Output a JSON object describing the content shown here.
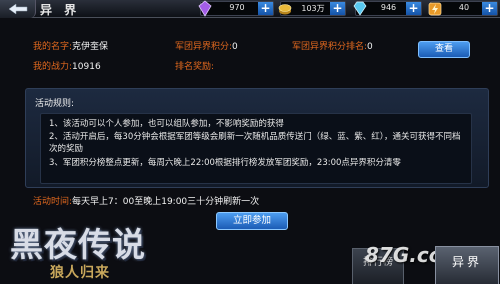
{
  "header": {
    "title": "异 界",
    "resources": [
      {
        "name": "crystal",
        "value": "970",
        "color": "#a45ee8"
      },
      {
        "name": "gold",
        "value": "103万",
        "color": "#e8b83a"
      },
      {
        "name": "diamond",
        "value": "946",
        "color": "#58c8f0"
      },
      {
        "name": "stamina",
        "value": "40",
        "color": "#e89a2a"
      }
    ],
    "plus_label": "+"
  },
  "info": {
    "name_label": "我的名字:",
    "name_value": "克伊奎保",
    "power_label": "我的战力:",
    "power_value": "10916",
    "legion_score_label": "军团异界积分:",
    "legion_score_value": "0",
    "legion_rank_label": "军团异界积分排名:",
    "legion_rank_value": "0",
    "rank_reward_label": "排名奖励:",
    "view_button": "查看"
  },
  "rules": {
    "title": "活动规则:",
    "items": [
      "1、该活动可以个人参加，也可以组队参加，不影响奖励的获得",
      "2、活动开启后，每30分钟会根据军团等级会刷新一次随机品质传送门（绿、蓝、紫、红），通关可获得不同档次的奖励",
      "3、军团积分榜整点更新，每周六晚上22:00根据排行榜发放军团奖励，23:00点异界积分清零"
    ]
  },
  "activity_time": {
    "label": "活动时间:",
    "value": "每天早上7：00至晚上19:00三十分钟刷新一次"
  },
  "join_button": "立即参加",
  "logo": {
    "main": "黑夜传说",
    "sub": "狼人归来"
  },
  "tabs": {
    "rank": "排行榜",
    "yijie": "异界"
  },
  "watermark": "87G.com"
}
